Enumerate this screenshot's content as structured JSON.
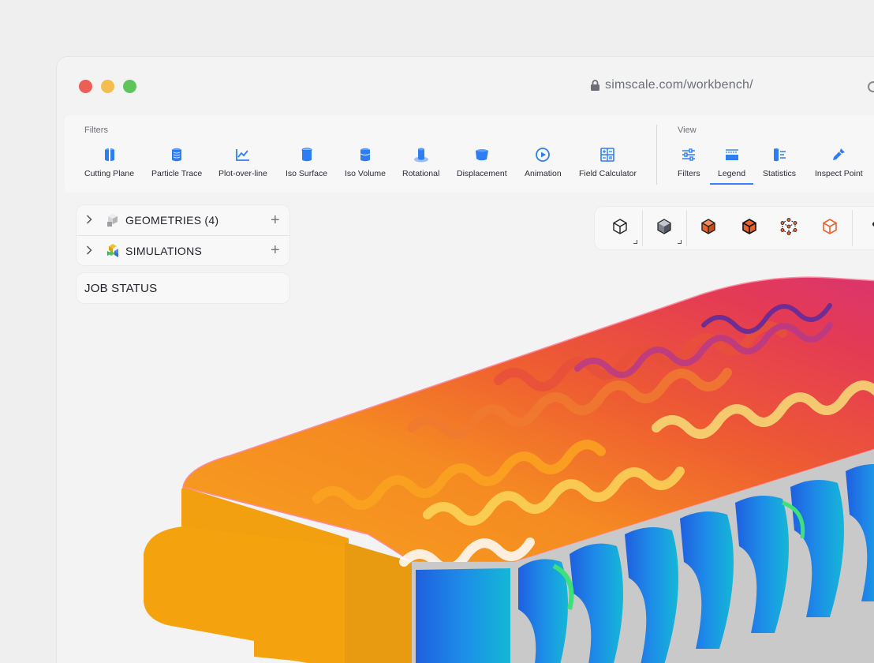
{
  "browser": {
    "url": "simscale.com/workbench/"
  },
  "toolbar": {
    "filters_label": "Filters",
    "view_label": "View",
    "filters": [
      {
        "label": "Cutting Plane",
        "icon": "cutting-plane-icon"
      },
      {
        "label": "Particle Trace",
        "icon": "particle-trace-icon"
      },
      {
        "label": "Plot-over-line",
        "icon": "plot-over-line-icon"
      },
      {
        "label": "Iso Surface",
        "icon": "iso-surface-icon"
      },
      {
        "label": "Iso Volume",
        "icon": "iso-volume-icon"
      },
      {
        "label": "Rotational",
        "icon": "rotational-icon"
      },
      {
        "label": "Displacement",
        "icon": "displacement-icon"
      },
      {
        "label": "Animation",
        "icon": "animation-icon"
      },
      {
        "label": "Field Calculator",
        "icon": "field-calculator-icon"
      }
    ],
    "view": [
      {
        "label": "Filters",
        "icon": "sliders-icon"
      },
      {
        "label": "Legend",
        "icon": "legend-icon",
        "active": true
      },
      {
        "label": "Statistics",
        "icon": "statistics-icon"
      },
      {
        "label": "Inspect Point",
        "icon": "pipette-icon"
      }
    ]
  },
  "tree": {
    "geometries": {
      "label": "GEOMETRIES",
      "count": "(4)"
    },
    "simulations": {
      "label": "SIMULATIONS"
    },
    "job_status": "JOB STATUS"
  },
  "colors": {
    "accent": "#3b82f6",
    "tool_icon": "#2f7df2",
    "orange_cube": "#e8622c"
  }
}
